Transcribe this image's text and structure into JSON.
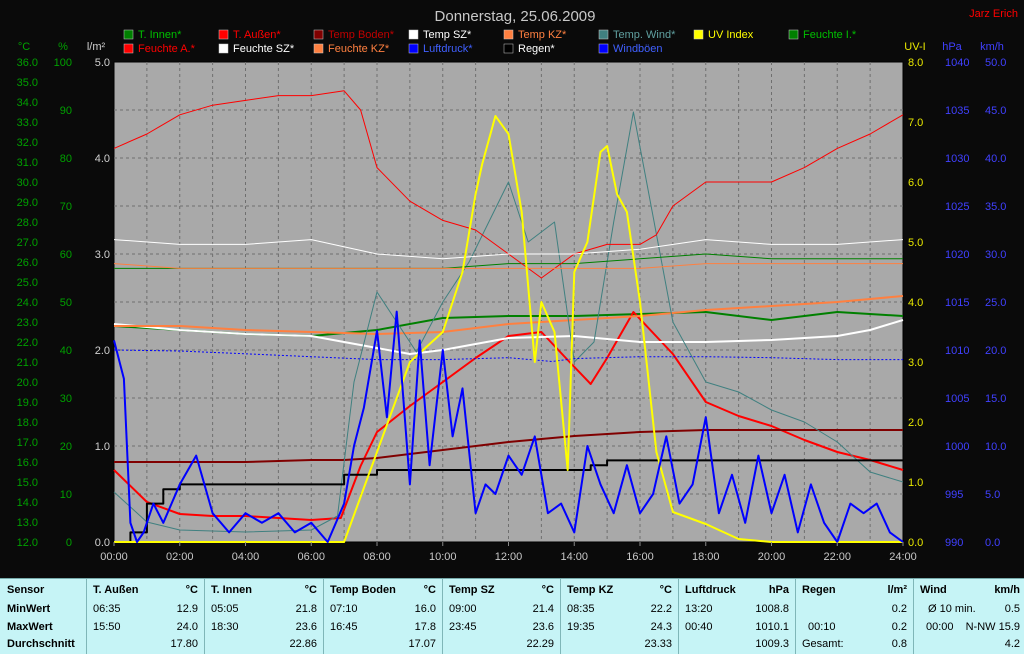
{
  "title": "Donnerstag, 25.06.2009",
  "author": "Jarz Erich",
  "legend": [
    {
      "label": "T. Innen*",
      "color": "#008000"
    },
    {
      "label": "T. Außen*",
      "color": "#ff0000"
    },
    {
      "label": "Temp Boden*",
      "color": "#800000"
    },
    {
      "label": "Temp SZ*",
      "color": "#ffffff"
    },
    {
      "label": "Temp KZ*",
      "color": "#ff8040"
    },
    {
      "label": "Temp. Wind*",
      "color": "#408080"
    },
    {
      "label": "UV Index",
      "color": "#ffff00"
    },
    {
      "label": "Feuchte I.*",
      "color": "#008000"
    },
    {
      "label": "Feuchte A.*",
      "color": "#ff0000"
    },
    {
      "label": "Feuchte SZ*",
      "color": "#ffffff"
    },
    {
      "label": "Feuchte KZ*",
      "color": "#ff8040"
    },
    {
      "label": "Luftdruck*",
      "color": "#0000ff"
    },
    {
      "label": "Regen*",
      "color": "#000000"
    },
    {
      "label": "Windböen",
      "color": "#0000ff"
    }
  ],
  "chart_data": {
    "type": "line",
    "x_ticks": [
      "00:00",
      "02:00",
      "04:00",
      "06:00",
      "08:00",
      "10:00",
      "12:00",
      "14:00",
      "16:00",
      "18:00",
      "20:00",
      "22:00",
      "24:00"
    ],
    "axes": {
      "temperature": {
        "unit": "°C",
        "range": [
          12.0,
          36.0
        ],
        "ticks": [
          "36.0",
          "35.0",
          "34.0",
          "33.0",
          "32.0",
          "31.0",
          "30.0",
          "29.0",
          "28.0",
          "27.0",
          "26.0",
          "25.0",
          "24.0",
          "23.0",
          "22.0",
          "21.0",
          "20.0",
          "19.0",
          "18.0",
          "17.0",
          "16.0",
          "15.0",
          "14.0",
          "13.0",
          "12.0"
        ]
      },
      "humidity": {
        "unit": "%",
        "range": [
          0,
          100
        ],
        "ticks": [
          "100",
          "90",
          "80",
          "70",
          "60",
          "50",
          "40",
          "30",
          "20",
          "10",
          "0"
        ]
      },
      "rain": {
        "unit": "l/m²",
        "range": [
          0.0,
          5.0
        ],
        "ticks": [
          "5.0",
          "4.0",
          "3.0",
          "2.0",
          "1.0",
          "0.0"
        ]
      },
      "uv": {
        "unit": "UV-I",
        "range": [
          0.0,
          8.0
        ],
        "ticks": [
          "8.0",
          "7.0",
          "6.0",
          "5.0",
          "4.0",
          "3.0",
          "2.0",
          "1.0",
          "0.0"
        ]
      },
      "pressure": {
        "unit": "hPa",
        "range": [
          990,
          1040
        ],
        "ticks": [
          "1040",
          "1035",
          "1030",
          "1025",
          "1020",
          "1015",
          "1010",
          "1005",
          "1000",
          "995",
          "990"
        ]
      },
      "wind": {
        "unit": "km/h",
        "range": [
          0.0,
          50.0
        ],
        "ticks": [
          "50.0",
          "45.0",
          "40.0",
          "35.0",
          "30.0",
          "25.0",
          "20.0",
          "15.0",
          "10.0",
          "5.0",
          "0.0"
        ]
      }
    },
    "series": [
      {
        "name": "T. Innen*",
        "axis": "temperature",
        "color": "#008000",
        "x": [
          0,
          2,
          4,
          6,
          8,
          10,
          12,
          14,
          16,
          18,
          20,
          22,
          24
        ],
        "y": [
          22.8,
          22.6,
          22.4,
          22.3,
          22.6,
          23.2,
          23.3,
          23.3,
          23.4,
          23.5,
          23.1,
          23.5,
          23.3
        ]
      },
      {
        "name": "T. Außen*",
        "axis": "temperature",
        "color": "#ff0000",
        "x": [
          0,
          1,
          2,
          3,
          4,
          5,
          6,
          6.9,
          7.5,
          8,
          9,
          10,
          11,
          12,
          13,
          13.8,
          14.5,
          15,
          15.8,
          17,
          18,
          19,
          20,
          21,
          22,
          23,
          24
        ],
        "y": [
          15.6,
          14.0,
          13.4,
          13.3,
          13.3,
          13.2,
          13.1,
          13.2,
          15.8,
          17.5,
          18.8,
          20.0,
          21.2,
          22.3,
          22.5,
          21.1,
          19.9,
          21.2,
          23.5,
          21.4,
          19.0,
          18.3,
          17.8,
          17.1,
          16.5,
          16.1,
          15.6
        ]
      },
      {
        "name": "Temp Boden*",
        "axis": "temperature",
        "color": "#800000",
        "x": [
          0,
          2,
          4,
          6,
          7,
          8,
          10,
          12,
          14,
          16,
          18,
          20,
          22,
          24
        ],
        "y": [
          16.0,
          16.0,
          16.0,
          16.1,
          16.1,
          16.2,
          16.6,
          17.0,
          17.3,
          17.5,
          17.6,
          17.6,
          17.6,
          17.6
        ]
      },
      {
        "name": "Temp SZ*",
        "axis": "temperature",
        "color": "#ffffff",
        "x": [
          0,
          2,
          4,
          6,
          7,
          8,
          9,
          10,
          12,
          14,
          16,
          18,
          20,
          22,
          23,
          24
        ],
        "y": [
          22.9,
          22.6,
          22.4,
          22.3,
          22.0,
          21.7,
          21.4,
          21.6,
          22.2,
          22.3,
          22.0,
          22.0,
          22.1,
          22.3,
          22.6,
          23.1
        ]
      },
      {
        "name": "Temp KZ*",
        "axis": "temperature",
        "color": "#ff8040",
        "x": [
          0,
          2,
          4,
          6,
          8,
          10,
          12,
          14,
          16,
          18,
          20,
          22,
          24
        ],
        "y": [
          22.8,
          22.8,
          22.6,
          22.5,
          22.4,
          22.5,
          22.9,
          23.1,
          23.3,
          23.6,
          23.8,
          24.0,
          24.3
        ]
      },
      {
        "name": "Temp. Wind*",
        "axis": "temperature",
        "color": "#408080",
        "x": [
          0,
          1,
          2,
          4,
          6,
          6.8,
          7.3,
          8,
          8.6,
          9.2,
          10,
          10.8,
          11.4,
          12,
          12.6,
          13.4,
          14,
          14.6,
          15.2,
          15.8,
          16.2,
          17,
          18,
          19,
          20,
          21,
          22,
          23,
          24
        ],
        "y": [
          14.5,
          13.0,
          12.6,
          12.5,
          12.6,
          13.3,
          20.0,
          24.5,
          23.0,
          21.5,
          24.0,
          26.0,
          28.0,
          30.0,
          27.0,
          28.0,
          21.0,
          22.0,
          28.0,
          33.5,
          30.0,
          23.0,
          20.0,
          19.5,
          18.6,
          18.0,
          17.0,
          15.5,
          15.0
        ]
      },
      {
        "name": "Feuchte I.*",
        "axis": "humidity",
        "color": "#008000",
        "x": [
          0,
          2,
          4,
          6,
          8,
          10,
          12,
          14,
          16,
          18,
          20,
          22,
          24
        ],
        "y": [
          57,
          57,
          57,
          57,
          57,
          57,
          58,
          58,
          59,
          60,
          59,
          59,
          59
        ]
      },
      {
        "name": "Feuchte A.*",
        "axis": "humidity",
        "color": "#ff0000",
        "x": [
          0,
          1,
          2,
          3,
          4,
          5,
          6,
          7,
          7.5,
          8,
          9,
          10,
          11,
          12,
          13,
          14,
          15,
          16,
          16.5,
          17,
          18,
          19,
          20,
          21,
          22,
          23,
          24
        ],
        "y": [
          82,
          85,
          89,
          91,
          92,
          93,
          93,
          94,
          90,
          78,
          71,
          67,
          65,
          60,
          55,
          60,
          62,
          62,
          64,
          70,
          75,
          75,
          75,
          78,
          82,
          85,
          89
        ]
      },
      {
        "name": "Feuchte SZ*",
        "axis": "humidity",
        "color": "#ffffff",
        "x": [
          0,
          2,
          4,
          6,
          8,
          10,
          12,
          14,
          16,
          18,
          20,
          22,
          24
        ],
        "y": [
          63,
          62,
          62,
          63,
          60,
          59,
          60,
          60,
          61,
          63,
          62,
          62,
          63
        ]
      },
      {
        "name": "Feuchte KZ*",
        "axis": "humidity",
        "color": "#ff8040",
        "x": [
          0,
          2,
          4,
          6,
          8,
          10,
          12,
          14,
          16,
          18,
          20,
          22,
          24
        ],
        "y": [
          58,
          57,
          57,
          57,
          57,
          57,
          57,
          57,
          57,
          58,
          58,
          58,
          58
        ]
      },
      {
        "name": "Luftdruck*",
        "axis": "pressure",
        "color": "#0000ff",
        "x": [
          0,
          2,
          4,
          6,
          8,
          10,
          12,
          13.33,
          14,
          16,
          18,
          20,
          22,
          24
        ],
        "y": [
          1010.0,
          1009.9,
          1009.6,
          1009.3,
          1009.0,
          1009.0,
          1009.2,
          1008.8,
          1009.1,
          1009.3,
          1009.3,
          1009.2,
          1009.0,
          1009.0
        ]
      },
      {
        "name": "Regen*",
        "axis": "rain",
        "color": "#000000",
        "x": [
          0,
          0.5,
          1,
          1.5,
          2,
          6.9,
          7,
          8,
          13.9,
          14,
          14.5,
          15,
          16,
          24
        ],
        "y": [
          0,
          0.1,
          0.4,
          0.55,
          0.6,
          0.6,
          0.7,
          0.75,
          0.75,
          0.75,
          0.8,
          0.85,
          0.85,
          0.85
        ]
      },
      {
        "name": "UV Index",
        "axis": "uv",
        "color": "#ffff00",
        "x": [
          0,
          7,
          8,
          9,
          10,
          10.6,
          11,
          11.2,
          11.6,
          12,
          12.4,
          12.8,
          13,
          13.4,
          13.8,
          14,
          14.4,
          14.8,
          15,
          15.3,
          15.6,
          16,
          16.5,
          17,
          18,
          19,
          20,
          24
        ],
        "y": [
          0,
          0,
          1.5,
          3.0,
          3.5,
          4.5,
          5.8,
          6.3,
          7.1,
          6.8,
          5.5,
          3.0,
          4.0,
          3.5,
          1.2,
          4.5,
          5.0,
          6.5,
          6.6,
          5.8,
          5.5,
          4.0,
          1.5,
          0.5,
          0.3,
          0.05,
          0,
          0
        ]
      },
      {
        "name": "Windböen",
        "axis": "wind",
        "color": "#0000ff",
        "x": [
          0,
          0.3,
          0.5,
          0.7,
          0.9,
          1.2,
          1.5,
          2,
          2.5,
          3,
          3.5,
          4,
          4.5,
          5,
          5.5,
          6,
          6.5,
          7,
          7.3,
          7.6,
          8,
          8.3,
          8.6,
          9,
          9.3,
          9.6,
          10,
          10.3,
          10.6,
          11,
          11.3,
          11.6,
          12,
          12.4,
          12.8,
          13.2,
          13.6,
          14,
          14.4,
          14.8,
          15.2,
          15.6,
          16,
          16.4,
          16.8,
          17.2,
          17.6,
          18,
          18.4,
          18.8,
          19.2,
          19.6,
          20,
          20.4,
          20.8,
          21.2,
          21.6,
          22,
          22.4,
          22.8,
          23.2,
          23.6,
          24
        ],
        "y": [
          21,
          17,
          2,
          0,
          1,
          4,
          2,
          6,
          9,
          3,
          1,
          3,
          2,
          3,
          1,
          2,
          0,
          4,
          10,
          14,
          22,
          13,
          24,
          6,
          21,
          8,
          20,
          11,
          16,
          3,
          6,
          5,
          9,
          7,
          11,
          3,
          4,
          1,
          10,
          6,
          3,
          8,
          3,
          5,
          11,
          4,
          6,
          13,
          3,
          7,
          2,
          9,
          3,
          7,
          1,
          6,
          2,
          0,
          4,
          3,
          4,
          1,
          0
        ]
      }
    ]
  },
  "table": {
    "row_labels": {
      "sensor": "Sensor",
      "min": "MinWert",
      "max": "MaxWert",
      "avg": "Durchschnitt"
    },
    "columns": [
      {
        "name": "T. Außen",
        "unit": "°C",
        "min_time": "06:35",
        "min_val": "12.9",
        "max_time": "15:50",
        "max_val": "24.0",
        "avg": "17.80"
      },
      {
        "name": "T. Innen",
        "unit": "°C",
        "min_time": "05:05",
        "min_val": "21.8",
        "max_time": "18:30",
        "max_val": "23.6",
        "avg": "22.86"
      },
      {
        "name": "Temp Boden",
        "unit": "°C",
        "min_time": "07:10",
        "min_val": "16.0",
        "max_time": "16:45",
        "max_val": "17.8",
        "avg": "17.07"
      },
      {
        "name": "Temp SZ",
        "unit": "°C",
        "min_time": "09:00",
        "min_val": "21.4",
        "max_time": "23:45",
        "max_val": "23.6",
        "avg": "22.29"
      },
      {
        "name": "Temp KZ",
        "unit": "°C",
        "min_time": "08:35",
        "min_val": "22.2",
        "max_time": "19:35",
        "max_val": "24.3",
        "avg": "23.33"
      },
      {
        "name": "Luftdruck",
        "unit": "hPa",
        "min_time": "13:20",
        "min_val": "1008.8",
        "max_time": "00:40",
        "max_val": "1010.1",
        "avg": "1009.3"
      }
    ],
    "regen": {
      "name": "Regen",
      "unit": "l/m²",
      "min_val": "0.2",
      "max_time": "00:10",
      "max_val": "0.2",
      "total_label": "Gesamt:",
      "total_val": "0.8"
    },
    "wind": {
      "name": "Wind",
      "unit": "km/h",
      "avg_label": "Ø 10 min.",
      "avg_val": "0.5",
      "max_time": "00:00",
      "max_val": "N-NW 15.9",
      "gust": "4.2"
    }
  }
}
